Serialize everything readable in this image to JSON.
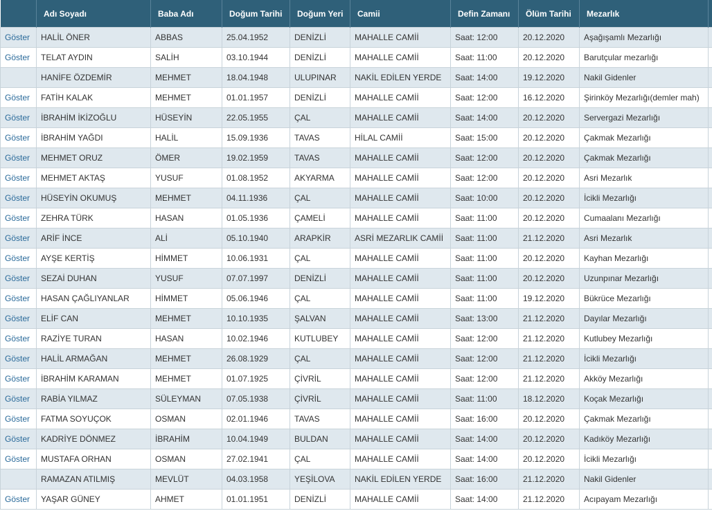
{
  "headers": [
    "",
    "Adı Soyadı",
    "Baba Adı",
    "Doğum Tarihi",
    "Doğum Yeri",
    "Camii",
    "Defin Zamanı",
    "Ölüm Tarihi",
    "Mezarlık",
    ""
  ],
  "show_label": "Göster",
  "rows": [
    {
      "show": "Göster",
      "name": "HALİL ÖNER",
      "father": "ABBAS",
      "birth_date": "25.04.1952",
      "birth_place": "DENİZLİ",
      "mosque": "MAHALLE CAMİİ",
      "burial_time": "Saat: 12:00",
      "death_date": "20.12.2020",
      "cemetery": "Aşağışamlı Mezarlığı"
    },
    {
      "show": "Göster",
      "name": "TELAT AYDIN",
      "father": "SALİH",
      "birth_date": "03.10.1944",
      "birth_place": "DENİZLİ",
      "mosque": "MAHALLE CAMİİ",
      "burial_time": "Saat: 11:00",
      "death_date": "20.12.2020",
      "cemetery": "Barutçular mezarlığı"
    },
    {
      "show": "",
      "name": "HANİFE ÖZDEMİR",
      "father": "MEHMET",
      "birth_date": "18.04.1948",
      "birth_place": "ULUPINAR",
      "mosque": "NAKİL EDİLEN YERDE",
      "burial_time": "Saat: 14:00",
      "death_date": "19.12.2020",
      "cemetery": "Nakil Gidenler"
    },
    {
      "show": "Göster",
      "name": "FATİH KALAK",
      "father": "MEHMET",
      "birth_date": "01.01.1957",
      "birth_place": "DENİZLİ",
      "mosque": "MAHALLE CAMİİ",
      "burial_time": "Saat: 12:00",
      "death_date": "16.12.2020",
      "cemetery": "Şirinköy Mezarlığı(demler mah)"
    },
    {
      "show": "Göster",
      "name": "İBRAHİM İKİZOĞLU",
      "father": "HÜSEYİN",
      "birth_date": "22.05.1955",
      "birth_place": "ÇAL",
      "mosque": "MAHALLE CAMİİ",
      "burial_time": "Saat: 14:00",
      "death_date": "20.12.2020",
      "cemetery": "Servergazi Mezarlığı"
    },
    {
      "show": "Göster",
      "name": "İBRAHİM YAĞDI",
      "father": "HALİL",
      "birth_date": "15.09.1936",
      "birth_place": "TAVAS",
      "mosque": "HİLAL CAMİİ",
      "burial_time": "Saat: 15:00",
      "death_date": "20.12.2020",
      "cemetery": "Çakmak Mezarlığı"
    },
    {
      "show": "Göster",
      "name": "MEHMET ORUZ",
      "father": "ÖMER",
      "birth_date": "19.02.1959",
      "birth_place": "TAVAS",
      "mosque": "MAHALLE CAMİİ",
      "burial_time": "Saat: 12:00",
      "death_date": "20.12.2020",
      "cemetery": "Çakmak Mezarlığı"
    },
    {
      "show": "Göster",
      "name": "MEHMET AKTAŞ",
      "father": "YUSUF",
      "birth_date": "01.08.1952",
      "birth_place": "AKYARMA",
      "mosque": "MAHALLE CAMİİ",
      "burial_time": "Saat: 12:00",
      "death_date": "20.12.2020",
      "cemetery": "Asri Mezarlık"
    },
    {
      "show": "Göster",
      "name": "HÜSEYİN OKUMUŞ",
      "father": "MEHMET",
      "birth_date": "04.11.1936",
      "birth_place": "ÇAL",
      "mosque": "MAHALLE CAMİİ",
      "burial_time": "Saat: 10:00",
      "death_date": "20.12.2020",
      "cemetery": "İcikli Mezarlığı"
    },
    {
      "show": "Göster",
      "name": "ZEHRA TÜRK",
      "father": "HASAN",
      "birth_date": "01.05.1936",
      "birth_place": "ÇAMELİ",
      "mosque": "MAHALLE CAMİİ",
      "burial_time": "Saat: 11:00",
      "death_date": "20.12.2020",
      "cemetery": "Cumaalanı Mezarlığı"
    },
    {
      "show": "Göster",
      "name": "ARİF İNCE",
      "father": "ALİ",
      "birth_date": "05.10.1940",
      "birth_place": "ARAPKİR",
      "mosque": "ASRİ MEZARLIK CAMİİ",
      "burial_time": "Saat: 11:00",
      "death_date": "21.12.2020",
      "cemetery": "Asri Mezarlık"
    },
    {
      "show": "Göster",
      "name": "AYŞE KERTİŞ",
      "father": "HİMMET",
      "birth_date": "10.06.1931",
      "birth_place": "ÇAL",
      "mosque": "MAHALLE CAMİİ",
      "burial_time": "Saat: 11:00",
      "death_date": "20.12.2020",
      "cemetery": "Kayhan Mezarlığı"
    },
    {
      "show": "Göster",
      "name": "SEZAİ DUHAN",
      "father": "YUSUF",
      "birth_date": "07.07.1997",
      "birth_place": "DENİZLİ",
      "mosque": "MAHALLE CAMİİ",
      "burial_time": "Saat: 11:00",
      "death_date": "20.12.2020",
      "cemetery": "Uzunpınar Mezarlığı"
    },
    {
      "show": "Göster",
      "name": "HASAN ÇAĞLIYANLAR",
      "father": "HİMMET",
      "birth_date": "05.06.1946",
      "birth_place": "ÇAL",
      "mosque": "MAHALLE CAMİİ",
      "burial_time": "Saat: 11:00",
      "death_date": "19.12.2020",
      "cemetery": "Bükrüce Mezarlığı"
    },
    {
      "show": "Göster",
      "name": "ELİF CAN",
      "father": "MEHMET",
      "birth_date": "10.10.1935",
      "birth_place": "ŞALVAN",
      "mosque": "MAHALLE CAMİİ",
      "burial_time": "Saat: 13:00",
      "death_date": "21.12.2020",
      "cemetery": "Dayılar Mezarlığı"
    },
    {
      "show": "Göster",
      "name": "RAZİYE TURAN",
      "father": "HASAN",
      "birth_date": "10.02.1946",
      "birth_place": "KUTLUBEY",
      "mosque": "MAHALLE CAMİİ",
      "burial_time": "Saat: 12:00",
      "death_date": "21.12.2020",
      "cemetery": "Kutlubey Mezarlığı"
    },
    {
      "show": "Göster",
      "name": "HALİL ARMAĞAN",
      "father": "MEHMET",
      "birth_date": "26.08.1929",
      "birth_place": "ÇAL",
      "mosque": "MAHALLE CAMİİ",
      "burial_time": "Saat: 12:00",
      "death_date": "21.12.2020",
      "cemetery": "İcikli Mezarlığı"
    },
    {
      "show": "Göster",
      "name": "İBRAHİM KARAMAN",
      "father": "MEHMET",
      "birth_date": "01.07.1925",
      "birth_place": "ÇİVRİL",
      "mosque": "MAHALLE CAMİİ",
      "burial_time": "Saat: 12:00",
      "death_date": "21.12.2020",
      "cemetery": "Akköy Mezarlığı"
    },
    {
      "show": "Göster",
      "name": "RABİA YILMAZ",
      "father": "SÜLEYMAN",
      "birth_date": "07.05.1938",
      "birth_place": "ÇİVRİL",
      "mosque": "MAHALLE CAMİİ",
      "burial_time": "Saat: 11:00",
      "death_date": "18.12.2020",
      "cemetery": "Koçak Mezarlığı"
    },
    {
      "show": "Göster",
      "name": "FATMA SOYUÇOK",
      "father": "OSMAN",
      "birth_date": "02.01.1946",
      "birth_place": "TAVAS",
      "mosque": "MAHALLE CAMİİ",
      "burial_time": "Saat: 16:00",
      "death_date": "20.12.2020",
      "cemetery": "Çakmak Mezarlığı"
    },
    {
      "show": "Göster",
      "name": "KADRİYE DÖNMEZ",
      "father": "İBRAHİM",
      "birth_date": "10.04.1949",
      "birth_place": "BULDAN",
      "mosque": "MAHALLE CAMİİ",
      "burial_time": "Saat: 14:00",
      "death_date": "20.12.2020",
      "cemetery": "Kadıköy Mezarlığı"
    },
    {
      "show": "Göster",
      "name": "MUSTAFA ORHAN",
      "father": "OSMAN",
      "birth_date": "27.02.1941",
      "birth_place": "ÇAL",
      "mosque": "MAHALLE CAMİİ",
      "burial_time": "Saat: 14:00",
      "death_date": "20.12.2020",
      "cemetery": "İcikli Mezarlığı"
    },
    {
      "show": "",
      "name": "RAMAZAN ATILMIŞ",
      "father": "MEVLÜT",
      "birth_date": "04.03.1958",
      "birth_place": "YEŞİLOVA",
      "mosque": "NAKİL EDİLEN YERDE",
      "burial_time": "Saat: 16:00",
      "death_date": "21.12.2020",
      "cemetery": "Nakil Gidenler"
    },
    {
      "show": "Göster",
      "name": "YAŞAR GÜNEY",
      "father": "AHMET",
      "birth_date": "01.01.1951",
      "birth_place": "DENİZLİ",
      "mosque": "MAHALLE CAMİİ",
      "burial_time": "Saat: 14:00",
      "death_date": "21.12.2020",
      "cemetery": "Acıpayam Mezarlığı"
    }
  ]
}
